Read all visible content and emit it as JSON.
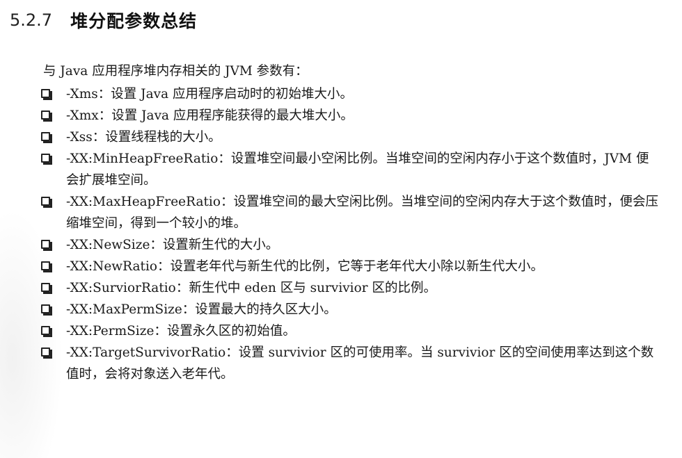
{
  "section": {
    "number": "5.2.7",
    "title": "堆分配参数总结"
  },
  "intro": "与 Java 应用程序堆内存相关的 JVM 参数有：",
  "bullet_icon": "checkbox-square-icon",
  "params": [
    {
      "text": "-Xms：设置 Java 应用程序启动时的初始堆大小。"
    },
    {
      "text": "-Xmx：设置 Java 应用程序能获得的最大堆大小。"
    },
    {
      "text": "-Xss：设置线程栈的大小。"
    },
    {
      "text": "-XX:MinHeapFreeRatio：设置堆空间最小空闲比例。当堆空间的空闲内存小于这个数值时，JVM 便会扩展堆空间。"
    },
    {
      "text": "-XX:MaxHeapFreeRatio：设置堆空间的最大空闲比例。当堆空间的空闲内存大于这个数值时，便会压缩堆空间，得到一个较小的堆。"
    },
    {
      "text": "-XX:NewSize：设置新生代的大小。"
    },
    {
      "text": "-XX:NewRatio：设置老年代与新生代的比例，它等于老年代大小除以新生代大小。"
    },
    {
      "text": "-XX:SurviorRatio：新生代中 eden 区与 survivior 区的比例。"
    },
    {
      "text": "-XX:MaxPermSize：设置最大的持久区大小。"
    },
    {
      "text": "-XX:PermSize：设置永久区的初始值。"
    },
    {
      "text": "-XX:TargetSurvivorRatio：设置 survivior 区的可使用率。当 survivior 区的空间使用率达到这个数值时，会将对象送入老年代。"
    }
  ]
}
